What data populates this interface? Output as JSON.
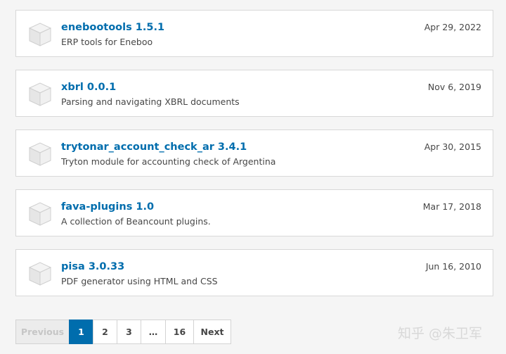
{
  "results": [
    {
      "title": "enebootools 1.5.1",
      "description": "ERP tools for Eneboo",
      "date": "Apr 29, 2022"
    },
    {
      "title": "xbrl 0.0.1",
      "description": "Parsing and navigating XBRL documents",
      "date": "Nov 6, 2019"
    },
    {
      "title": "trytonar_account_check_ar 3.4.1",
      "description": "Tryton module for accounting check of Argentina",
      "date": "Apr 30, 2015"
    },
    {
      "title": "fava-plugins 1.0",
      "description": "A collection of Beancount plugins.",
      "date": "Mar 17, 2018"
    },
    {
      "title": "pisa 3.0.33",
      "description": "PDF generator using HTML and CSS",
      "date": "Jun 16, 2010"
    }
  ],
  "pagination": {
    "previous": "Previous",
    "pages": [
      "1",
      "2",
      "3",
      "…",
      "16"
    ],
    "current": "1",
    "next": "Next"
  },
  "watermark": "知乎 @朱卫军",
  "icons": {
    "package": "package-box-icon"
  },
  "colors": {
    "link": "#006dad",
    "active_page": "#006dad"
  }
}
